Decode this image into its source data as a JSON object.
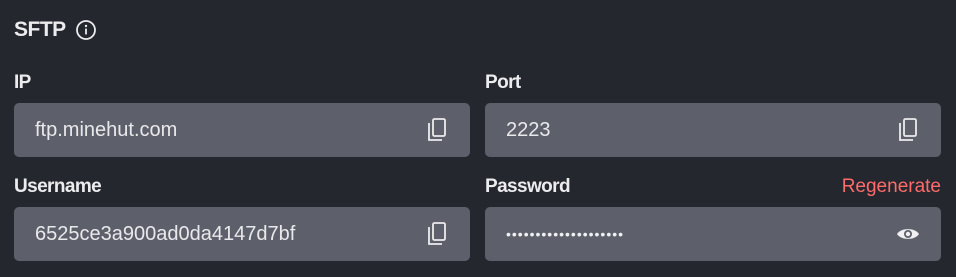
{
  "section": {
    "title": "SFTP"
  },
  "fields": {
    "ip": {
      "label": "IP",
      "value": "ftp.minehut.com"
    },
    "port": {
      "label": "Port",
      "value": "2223"
    },
    "username": {
      "label": "Username",
      "value": "6525ce3a900ad0da4147d7bf"
    },
    "password": {
      "label": "Password",
      "value": "••••••••••••••••••••",
      "action_label": "Regenerate"
    }
  },
  "icons": {
    "info": "info-icon",
    "copy": "copy-icon",
    "reveal": "eye-icon"
  },
  "colors": {
    "background": "#24272e",
    "field": "#5d606b",
    "danger": "#ff6b6b",
    "text": "#e6e6e8"
  }
}
